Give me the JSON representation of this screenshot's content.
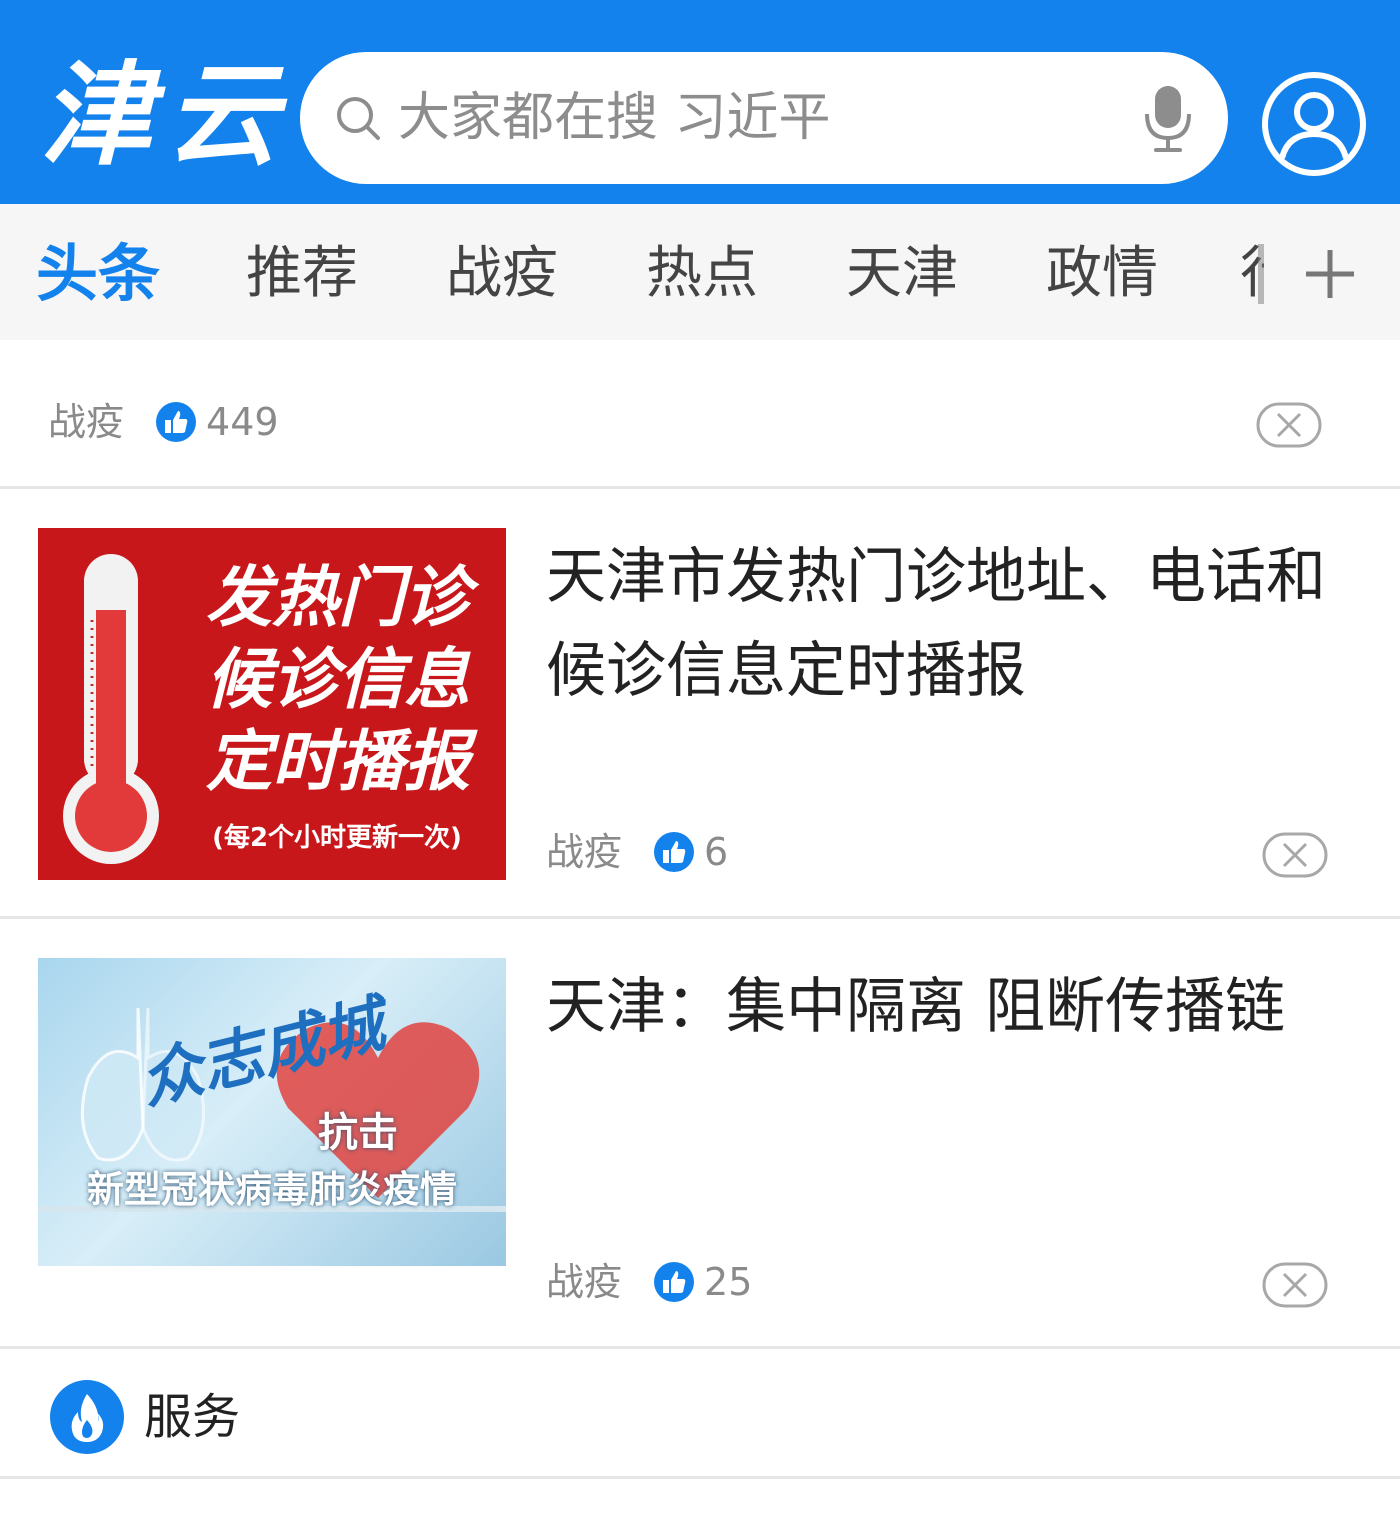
{
  "header": {
    "logo_text": "津云",
    "search_placeholder": "大家都在搜 习近平",
    "colors": {
      "brand": "#1382ec",
      "text_muted": "#8a8a8a"
    }
  },
  "tabs": {
    "items": [
      {
        "label": "头条",
        "active": true
      },
      {
        "label": "推荐"
      },
      {
        "label": "战疫"
      },
      {
        "label": "热点"
      },
      {
        "label": "天津"
      },
      {
        "label": "政情"
      }
    ],
    "clipped_label": "行"
  },
  "feed": {
    "items": [
      {
        "category": "战疫",
        "likes": "449"
      },
      {
        "title": "天津市发热门诊地址、电话和候诊信息定时播报",
        "category": "战疫",
        "likes": "6",
        "thumb": {
          "line1": "发热门诊",
          "line2": "候诊信息",
          "line3": "定时播报",
          "note": "(每2个小时更新一次)"
        }
      },
      {
        "title": "天津：集中隔离 阻断传播链",
        "category": "战疫",
        "likes": "25",
        "thumb": {
          "script": "众志成城",
          "fight": "抗击",
          "line2": "新型冠状病毒肺炎疫情"
        }
      }
    ]
  },
  "service": {
    "label": "服务"
  }
}
